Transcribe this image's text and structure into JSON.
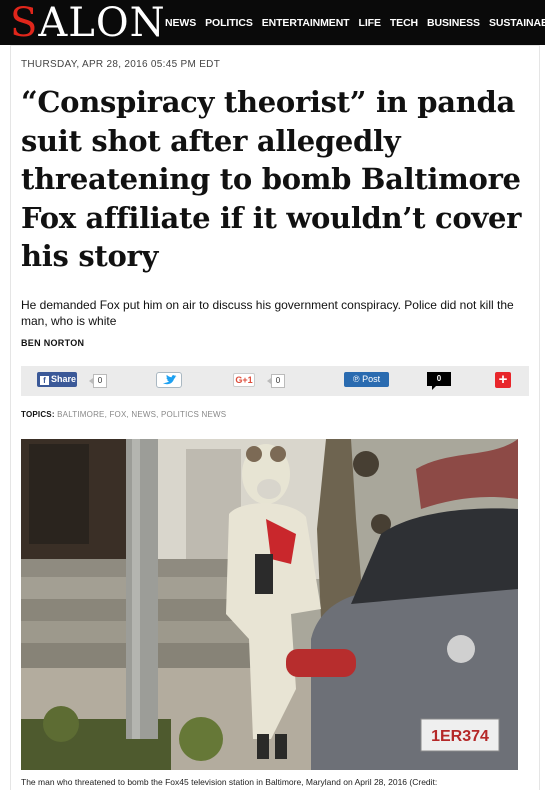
{
  "header": {
    "logo": "SALON",
    "nav": [
      "NEWS",
      "POLITICS",
      "ENTERTAINMENT",
      "LIFE",
      "TECH",
      "BUSINESS",
      "SUSTAINABILITY"
    ]
  },
  "article": {
    "dateline": "THURSDAY, APR 28, 2016 05:45 PM EDT",
    "headline": "“Conspiracy theorist” in panda suit shot after allegedly threatening to bomb Baltimore Fox affiliate if it wouldn’t cover his story",
    "dek": "He demanded Fox put him on air to discuss his government conspiracy. Police did not kill the man, who is white",
    "byline": "BEN NORTON",
    "caption": "The man who threatened to bomb the Fox45 television station in Baltimore, Maryland on April 28, 2016 (Credit:"
  },
  "share": {
    "facebook_label": "Share",
    "facebook_count": "0",
    "google_label": "G+1",
    "google_count": "0",
    "post_label": "Post",
    "comment_count": "0",
    "plus_label": "+"
  },
  "topics": {
    "label": "TOPICS:",
    "items": [
      "BALTIMORE",
      "FOX",
      "NEWS",
      "POLITICS NEWS"
    ]
  },
  "photo": {
    "plate_text": "1ER374"
  },
  "colors": {
    "topbar": "#0a0a0a",
    "logo_accent": "#e0261b",
    "facebook": "#3b5998",
    "twitter": "#1da1f2",
    "google": "#dd4b39",
    "post": "#2a6bb0",
    "plus": "#e8262b"
  },
  "icons": {
    "facebook": "facebook-icon",
    "twitter": "twitter-bird-icon",
    "google": "google-plus-icon",
    "post": "post-icon",
    "comment": "comment-bubble-icon",
    "plus": "plus-icon"
  }
}
